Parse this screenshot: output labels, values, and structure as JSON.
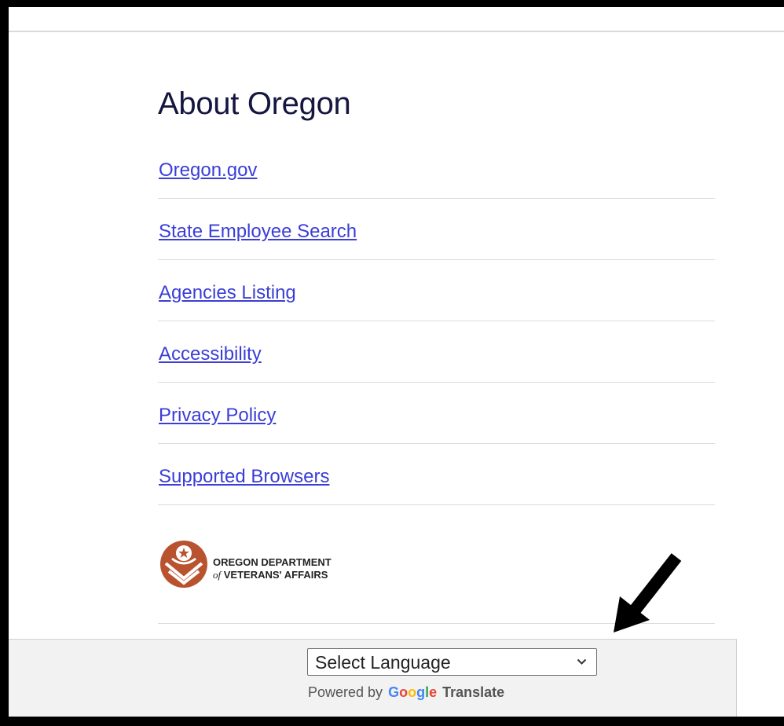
{
  "footer": {
    "heading": "About Oregon",
    "links": [
      {
        "label": "Oregon.gov"
      },
      {
        "label": "State Employee Search"
      },
      {
        "label": "Agencies Listing"
      },
      {
        "label": "Accessibility"
      },
      {
        "label": "Privacy Policy"
      },
      {
        "label": "Supported Browsers"
      }
    ],
    "logo": {
      "line1": "OREGON DEPARTMENT",
      "line2_prefix": "of",
      "line2": "VETERANS' AFFAIRS"
    }
  },
  "translate": {
    "select_label": "Select Language",
    "powered_by": "Powered by",
    "google_letters": [
      "G",
      "o",
      "o",
      "g",
      "l",
      "e"
    ],
    "translate_word": "Translate"
  },
  "colors": {
    "link": "#3a3ed6",
    "heading": "#14163f",
    "seal": "#b9532f",
    "panel_bg": "#f2f2f2"
  }
}
